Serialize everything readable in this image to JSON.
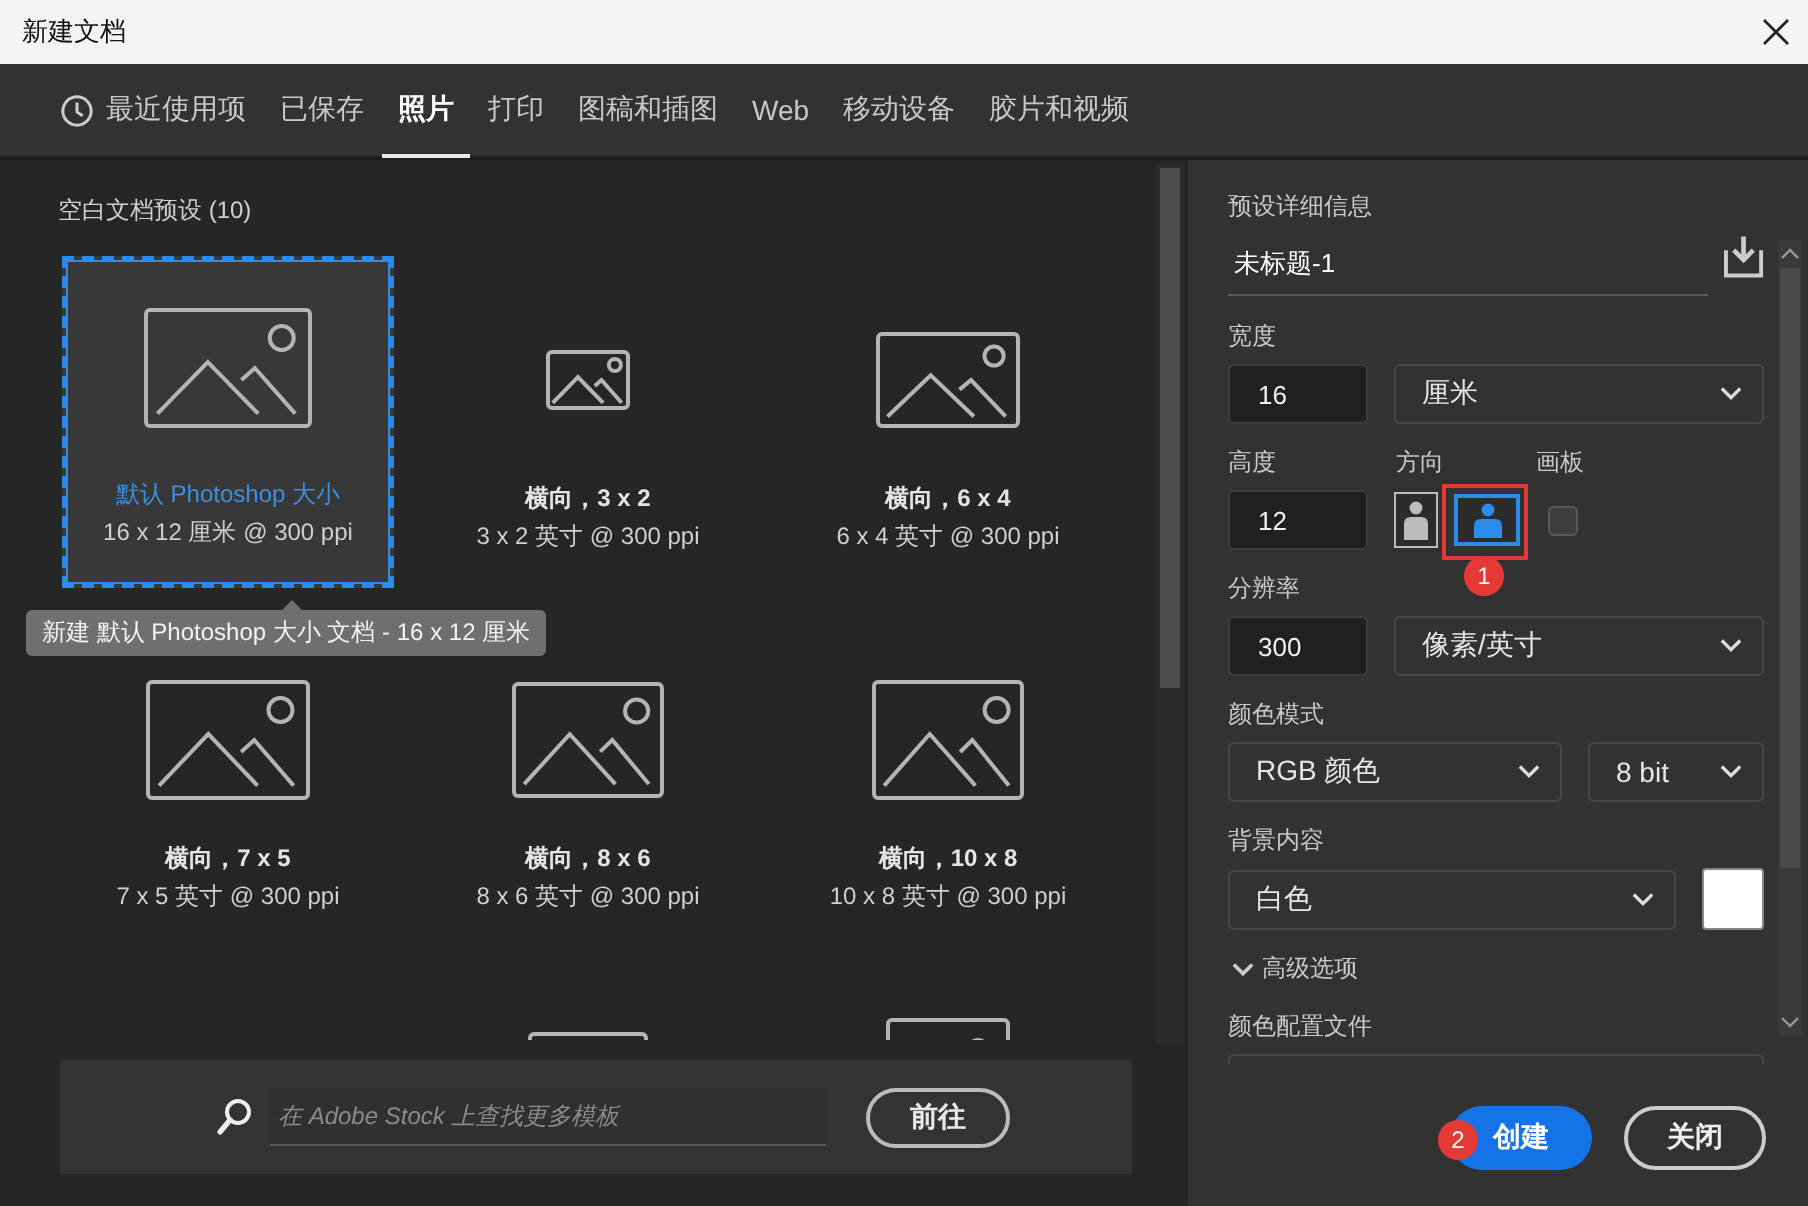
{
  "window": {
    "title": "新建文档"
  },
  "tabs": [
    {
      "label": "最近使用项",
      "selected": false,
      "kind": "recent"
    },
    {
      "label": "已保存",
      "selected": false,
      "kind": "plain"
    },
    {
      "label": "照片",
      "selected": true,
      "kind": "plain"
    },
    {
      "label": "打印",
      "selected": false,
      "kind": "plain"
    },
    {
      "label": "图稿和插图",
      "selected": false,
      "kind": "plain"
    },
    {
      "label": "Web",
      "selected": false,
      "kind": "plain"
    },
    {
      "label": "移动设备",
      "selected": false,
      "kind": "plain"
    },
    {
      "label": "胶片和视频",
      "selected": false,
      "kind": "plain"
    }
  ],
  "presets": {
    "heading": "空白文档预设 (10)",
    "tooltip": "新建 默认 Photoshop 大小 文档 - 16 x 12 厘米",
    "items": [
      {
        "title": "默认 Photoshop 大小",
        "subtitle": "16 x 12 厘米 @ 300 ppi",
        "selected": true
      },
      {
        "title": "横向，3 x 2",
        "subtitle": "3 x 2 英寸 @ 300 ppi",
        "selected": false
      },
      {
        "title": "横向，6 x 4",
        "subtitle": "6 x 4 英寸 @ 300 ppi",
        "selected": false
      },
      {
        "title": "横向，7 x 5",
        "subtitle": "7 x 5 英寸 @ 300 ppi",
        "selected": false
      },
      {
        "title": "横向，8 x 6",
        "subtitle": "8 x 6 英寸 @ 300 ppi",
        "selected": false
      },
      {
        "title": "横向，10 x 8",
        "subtitle": "10 x 8 英寸 @ 300 ppi",
        "selected": false
      }
    ]
  },
  "stock_search": {
    "placeholder": "在 Adobe Stock 上查找更多模板",
    "button": "前往"
  },
  "details": {
    "heading": "预设详细信息",
    "name": "未标题-1",
    "width": {
      "label": "宽度",
      "value": "16",
      "unit": "厘米"
    },
    "height": {
      "label": "高度",
      "value": "12"
    },
    "orientation": {
      "label": "方向",
      "options": [
        {
          "kind": "portrait",
          "selected": false
        },
        {
          "kind": "landscape",
          "selected": true
        }
      ]
    },
    "artboard": {
      "label": "画板",
      "checked": false
    },
    "resolution": {
      "label": "分辨率",
      "value": "300",
      "unit": "像素/英寸"
    },
    "color_mode": {
      "label": "颜色模式",
      "mode": "RGB 颜色",
      "depth": "8 bit"
    },
    "background": {
      "label": "背景内容",
      "value": "白色"
    },
    "advanced": {
      "label": "高级选项",
      "expanded": true
    },
    "color_profile": {
      "label": "颜色配置文件"
    }
  },
  "annotations": [
    {
      "text": "1"
    },
    {
      "text": "2"
    }
  ],
  "buttons": [
    {
      "label": "创建",
      "kind": "primary"
    },
    {
      "label": "关闭",
      "kind": "secondary"
    }
  ]
}
